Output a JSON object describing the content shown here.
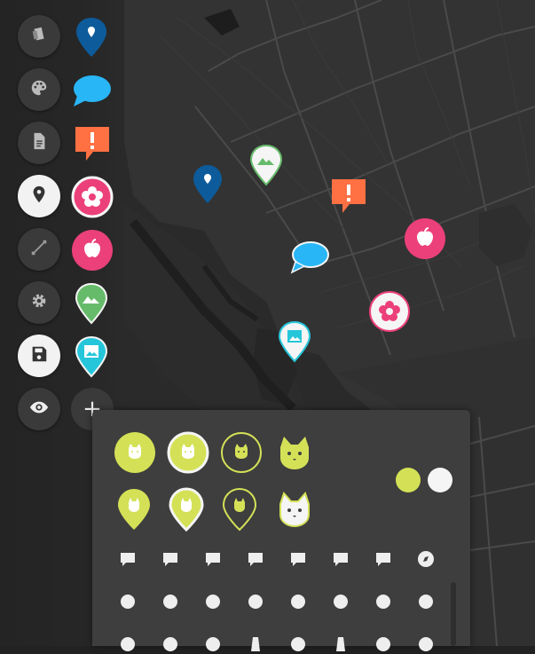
{
  "colors": {
    "accent": "#d4e157",
    "white": "#f5f5f5",
    "blue": "#0d5b9a",
    "cyan": "#29b6f6",
    "orange": "#ff7043",
    "pink": "#ec407a",
    "green": "#66bb6a",
    "teal": "#26c6da",
    "panel": "#3e3e3e"
  },
  "toolbar": {
    "buttons": [
      {
        "name": "layers-button",
        "icon": "layers-icon"
      },
      {
        "name": "style-button",
        "icon": "palette-icon"
      },
      {
        "name": "document-button",
        "icon": "document-icon"
      },
      {
        "name": "marker-button",
        "icon": "marker-icon"
      },
      {
        "name": "line-button",
        "icon": "polyline-icon"
      },
      {
        "name": "settings-button",
        "icon": "gear-icon"
      },
      {
        "name": "save-button",
        "icon": "save-icon"
      },
      {
        "name": "visibility-button",
        "icon": "eye-icon"
      }
    ],
    "add_label": "+"
  },
  "marker_presets": [
    {
      "name": "blue-pin",
      "icon": "location-pin-icon"
    },
    {
      "name": "cyan-bubble",
      "icon": "speech-bubble-icon"
    },
    {
      "name": "orange-alert",
      "icon": "alert-bubble-icon"
    },
    {
      "name": "pink-flower",
      "icon": "flower-icon"
    },
    {
      "name": "pink-apple",
      "icon": "apple-icon"
    },
    {
      "name": "green-mountain",
      "icon": "mountain-icon"
    },
    {
      "name": "teal-image",
      "icon": "image-icon"
    }
  ],
  "style_panel": {
    "shape_row1": [
      "circle-filled",
      "circle-bordered",
      "circle-outline",
      "icon-only"
    ],
    "shape_row2": [
      "pin-filled",
      "pin-bordered",
      "pin-outline",
      "icon-badge"
    ],
    "preview_icon": "cat-icon",
    "colors": [
      "#d4e157",
      "#f5f5f5"
    ],
    "icon_grid": [
      [
        "comment-eye-icon",
        "comment-plus-icon",
        "comment-dots-icon",
        "comment-question-icon",
        "comment-quote-icon",
        "comment-remove-icon",
        "comment-text-icon",
        "compass-icon"
      ],
      [
        "gamepad-icon",
        "cookie-icon",
        "cherries-icon",
        "cake-icon",
        "grapes-icon",
        "pineapple-icon",
        "watermelon-icon",
        "food-drink-icon"
      ],
      [
        "apple-core-icon",
        "rugby-icon",
        "fork-knife-icon",
        "bottle-icon",
        "carrot-icon",
        "cupcake-icon",
        "tulip-icon",
        "cookie-heart-icon"
      ]
    ]
  }
}
